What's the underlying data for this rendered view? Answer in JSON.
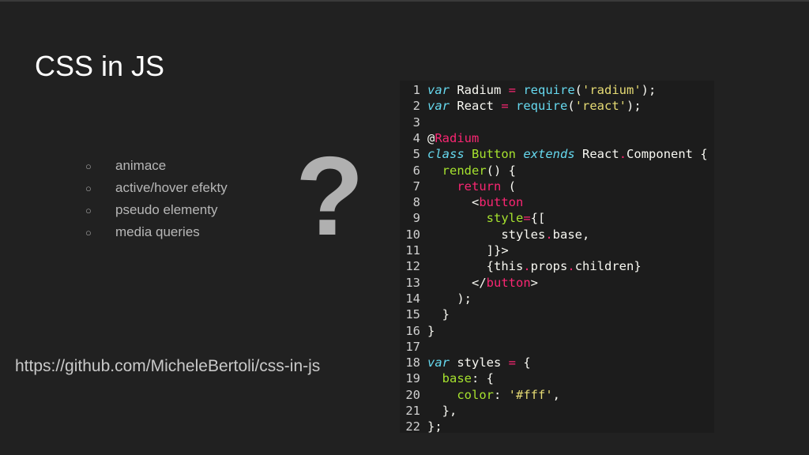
{
  "slide": {
    "title": "CSS in JS",
    "bullet_marker": "○",
    "bullets": [
      "animace",
      "active/hover efekty",
      "pseudo elementy",
      "media queries"
    ],
    "question_mark": "?",
    "link": "https://github.com/MicheleBertoli/css-in-js"
  },
  "code": {
    "language": "javascript",
    "lines": [
      [
        [
          "kw",
          "var"
        ],
        [
          "tx",
          " Radium "
        ],
        [
          "op",
          "="
        ],
        [
          "tx",
          " "
        ],
        [
          "fn",
          "require"
        ],
        [
          "tx",
          "("
        ],
        [
          "str",
          "'radium'"
        ],
        [
          "tx",
          ");"
        ]
      ],
      [
        [
          "kw",
          "var"
        ],
        [
          "tx",
          " React "
        ],
        [
          "op",
          "="
        ],
        [
          "tx",
          " "
        ],
        [
          "fn",
          "require"
        ],
        [
          "tx",
          "("
        ],
        [
          "str",
          "'react'"
        ],
        [
          "tx",
          ");"
        ]
      ],
      [],
      [
        [
          "tx",
          "@"
        ],
        [
          "op",
          "Radium"
        ]
      ],
      [
        [
          "kw",
          "class"
        ],
        [
          "tx",
          " "
        ],
        [
          "cls",
          "Button"
        ],
        [
          "tx",
          " "
        ],
        [
          "kw",
          "extends"
        ],
        [
          "tx",
          " React"
        ],
        [
          "op",
          "."
        ],
        [
          "tx",
          "Component {"
        ]
      ],
      [
        [
          "tx",
          "  "
        ],
        [
          "cls",
          "render"
        ],
        [
          "tx",
          "() {"
        ]
      ],
      [
        [
          "tx",
          "    "
        ],
        [
          "op",
          "return"
        ],
        [
          "tx",
          " ("
        ]
      ],
      [
        [
          "tx",
          "      <"
        ],
        [
          "op",
          "button"
        ]
      ],
      [
        [
          "tx",
          "        "
        ],
        [
          "cls",
          "style"
        ],
        [
          "op",
          "="
        ],
        [
          "tx",
          "{["
        ]
      ],
      [
        [
          "tx",
          "          styles"
        ],
        [
          "op",
          "."
        ],
        [
          "tx",
          "base,"
        ]
      ],
      [
        [
          "tx",
          "        ]}>"
        ]
      ],
      [
        [
          "tx",
          "        {this"
        ],
        [
          "op",
          "."
        ],
        [
          "tx",
          "props"
        ],
        [
          "op",
          "."
        ],
        [
          "tx",
          "children}"
        ]
      ],
      [
        [
          "tx",
          "      </"
        ],
        [
          "op",
          "button"
        ],
        [
          "tx",
          ">"
        ]
      ],
      [
        [
          "tx",
          "    );"
        ]
      ],
      [
        [
          "tx",
          "  }"
        ]
      ],
      [
        [
          "tx",
          "}"
        ]
      ],
      [],
      [
        [
          "kw",
          "var"
        ],
        [
          "tx",
          " styles "
        ],
        [
          "op",
          "="
        ],
        [
          "tx",
          " {"
        ]
      ],
      [
        [
          "tx",
          "  "
        ],
        [
          "cls",
          "base"
        ],
        [
          "tx",
          ": {"
        ]
      ],
      [
        [
          "tx",
          "    "
        ],
        [
          "cls",
          "color"
        ],
        [
          "tx",
          ": "
        ],
        [
          "str",
          "'#fff'"
        ],
        [
          "tx",
          ","
        ]
      ],
      [
        [
          "tx",
          "  },"
        ]
      ],
      [
        [
          "tx",
          "};"
        ]
      ]
    ]
  }
}
